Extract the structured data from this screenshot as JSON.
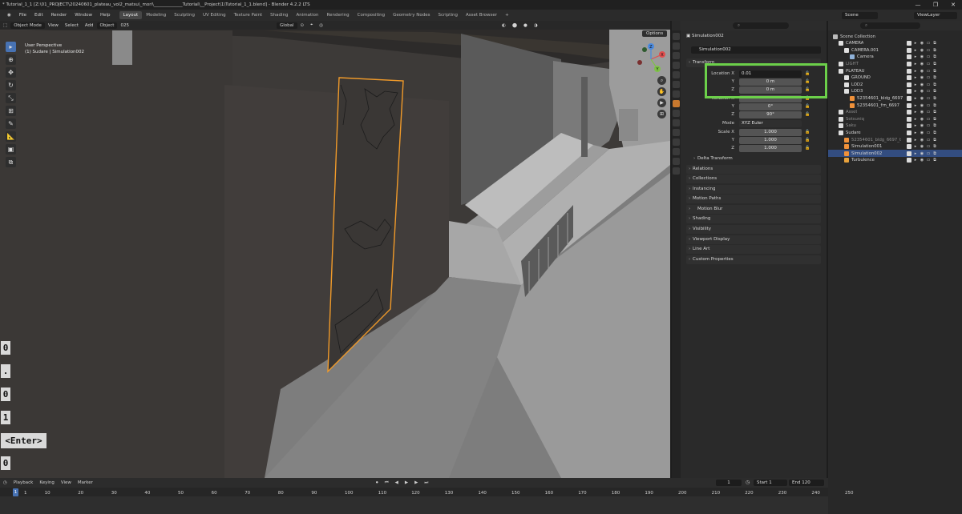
{
  "window": {
    "title": "* Tutorial_1_1 [Z:\\01_PROJECT\\20240601_plateau_vol2_matsu\\_mori\\_____________Tutorial\\__Project\\1\\Tutorial_1_1.blend] - Blender 4.2.2 LTS",
    "controls": [
      "—",
      "❐",
      "✕"
    ]
  },
  "menu": [
    "File",
    "Edit",
    "Render",
    "Window",
    "Help"
  ],
  "workspaces": [
    {
      "label": "Layout",
      "active": true
    },
    {
      "label": "Modeling"
    },
    {
      "label": "Sculpting"
    },
    {
      "label": "UV Editing"
    },
    {
      "label": "Texture Paint"
    },
    {
      "label": "Shading"
    },
    {
      "label": "Animation"
    },
    {
      "label": "Rendering"
    },
    {
      "label": "Compositing"
    },
    {
      "label": "Geometry Nodes"
    },
    {
      "label": "Scripting"
    },
    {
      "label": "Asset Browser"
    },
    {
      "label": "+"
    }
  ],
  "scene": {
    "name": "Scene",
    "view_layer": "ViewLayer"
  },
  "viewport": {
    "mode": "Object Mode",
    "menus": [
      "View",
      "Select",
      "Add",
      "Object"
    ],
    "orientation": "Global",
    "gizmo_label": "025",
    "info_line1": "User Perspective",
    "info_line2": "(1) Sudare | Simulation002",
    "options": "Options",
    "gizmo_axes": {
      "x": "X",
      "y": "Y",
      "z": "Z"
    },
    "typed_keys": [
      "0",
      ".",
      "0",
      "1"
    ],
    "enter_key": "<Enter>",
    "last_key": "0"
  },
  "properties": {
    "search_placeholder": "",
    "object_breadcrumb": "Simulation002",
    "object_name": "Simulation002",
    "transform_header": "Transform",
    "location": {
      "label_x": "Location X",
      "x": "0.01",
      "y": "0 m",
      "z": "0 m"
    },
    "rotation": {
      "label_x": "Rotation X",
      "x": "",
      "y": "0°",
      "z": "90°"
    },
    "mode_label": "Mode",
    "mode_value": "XYZ Euler",
    "scale": {
      "label_x": "Scale X",
      "x": "1.000",
      "y": "1.000",
      "z": "1.000"
    },
    "axis_y": "Y",
    "axis_z": "Z",
    "delta_transform": "Delta Transform",
    "sections": [
      "Relations",
      "Collections",
      "Instancing",
      "Motion Paths",
      "Motion Blur",
      "Shading",
      "Visibility",
      "Viewport Display",
      "Line Art",
      "Custom Properties"
    ]
  },
  "outliner": {
    "rows": [
      {
        "label": "Scene Collection",
        "indent": 0,
        "icon": "#bbbbbb"
      },
      {
        "label": "CAMERA",
        "indent": 1,
        "icon": "#e0e0e0"
      },
      {
        "label": "CAMERA.001",
        "indent": 2,
        "icon": "#e0e0e0"
      },
      {
        "label": "Camera",
        "indent": 3,
        "icon": "#8fb2d9"
      },
      {
        "label": "LIGHT",
        "indent": 1,
        "icon": "#e0e0e0",
        "dim": true
      },
      {
        "label": "PLATEAU",
        "indent": 1,
        "icon": "#e0e0e0"
      },
      {
        "label": "GROUND",
        "indent": 2,
        "icon": "#e0e0e0"
      },
      {
        "label": "LOD2",
        "indent": 2,
        "icon": "#e0e0e0"
      },
      {
        "label": "LOD3",
        "indent": 2,
        "icon": "#e0e0e0"
      },
      {
        "label": "52354601_bldg_6697",
        "indent": 3,
        "icon": "#f0913a"
      },
      {
        "label": "52354601_frn_6697",
        "indent": 3,
        "icon": "#f0913a"
      },
      {
        "label": "Asset",
        "indent": 1,
        "icon": "#e0e0e0",
        "dim": true
      },
      {
        "label": "Sotsuniq",
        "indent": 1,
        "icon": "#e0e0e0",
        "dim": true
      },
      {
        "label": "Saku",
        "indent": 1,
        "icon": "#e0e0e0",
        "dim": true
      },
      {
        "label": "Sudare",
        "indent": 1,
        "icon": "#e0e0e0"
      },
      {
        "label": "52354601_bldg_6697_t",
        "indent": 2,
        "icon": "#f0913a",
        "dim": true
      },
      {
        "label": "Simulation001",
        "indent": 2,
        "icon": "#f0913a"
      },
      {
        "label": "Simulation002",
        "indent": 2,
        "icon": "#f0913a",
        "selected": true
      },
      {
        "label": "Turbulence",
        "indent": 2,
        "icon": "#e8a23c"
      }
    ]
  },
  "timeline": {
    "menus": [
      "Playback",
      "Keying",
      "View",
      "Marker"
    ],
    "current_frame": "1",
    "start_label": "Start",
    "start": "1",
    "end_label": "End",
    "end": "120",
    "ticks": [
      "1",
      "10",
      "20",
      "30",
      "40",
      "50",
      "60",
      "70",
      "80",
      "90",
      "100",
      "110",
      "120",
      "130",
      "140",
      "150",
      "160",
      "170",
      "180",
      "190",
      "200",
      "210",
      "220",
      "230",
      "240",
      "250"
    ]
  },
  "colors": {
    "accent": "#4772b3",
    "highlight_box": "#6cd04a",
    "selection_outline": "#f09a2a"
  }
}
